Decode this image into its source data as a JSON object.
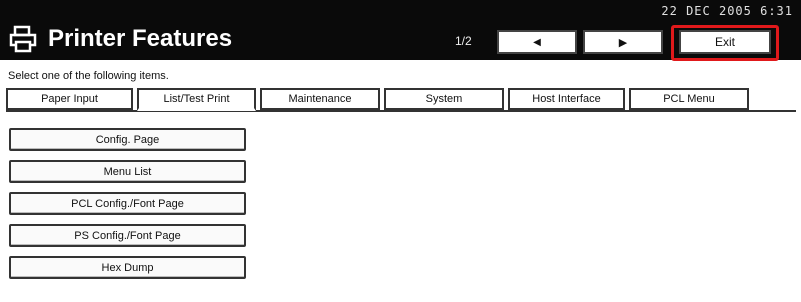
{
  "header": {
    "datetime": "22 DEC  2005  6:31",
    "title": "Printer Features",
    "page_indicator": "1/2",
    "prev_icon": "◀",
    "next_icon": "▶",
    "exit_label": "Exit"
  },
  "instruction": "Select one of the following items.",
  "tabs": [
    {
      "label": "Paper Input"
    },
    {
      "label": "List/Test Print"
    },
    {
      "label": "Maintenance"
    },
    {
      "label": "System"
    },
    {
      "label": "Host Interface"
    },
    {
      "label": "PCL Menu"
    }
  ],
  "items": [
    {
      "label": "Config. Page"
    },
    {
      "label": "Menu List"
    },
    {
      "label": "PCL Config./Font Page"
    },
    {
      "label": "PS Config./Font Page"
    },
    {
      "label": "Hex Dump"
    }
  ],
  "colors": {
    "header_bg": "#0a0a0a",
    "highlight": "#e0191b"
  }
}
